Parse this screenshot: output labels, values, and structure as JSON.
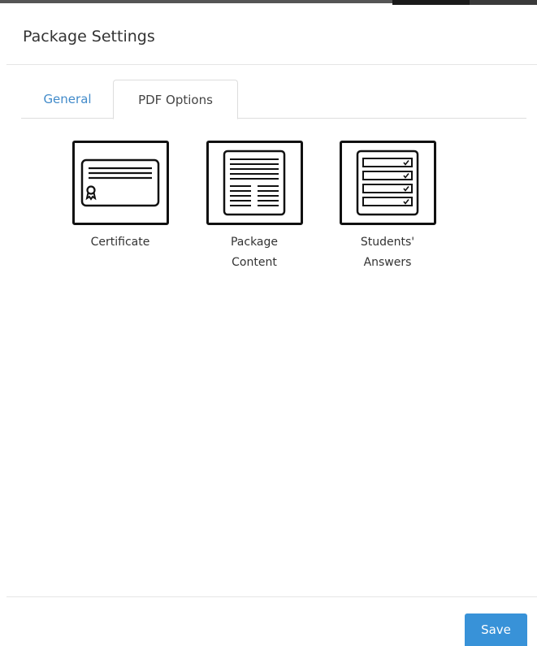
{
  "modal": {
    "title": "Package Settings"
  },
  "tabs": [
    {
      "label": "General",
      "active": false
    },
    {
      "label": "PDF Options",
      "active": true
    }
  ],
  "options": [
    {
      "label": "Certificate",
      "icon": "certificate-icon"
    },
    {
      "label": "Package Content",
      "label_line1": "Package",
      "label_line2": "Content",
      "icon": "package-content-icon"
    },
    {
      "label": "Students' Answers",
      "label_line1": "Students'",
      "label_line2": "Answers",
      "icon": "students-answers-icon"
    }
  ],
  "footer": {
    "save_label": "Save"
  },
  "colors": {
    "accent": "#3892d8",
    "tab_link": "#428bca",
    "icon_stroke": "#111111"
  }
}
